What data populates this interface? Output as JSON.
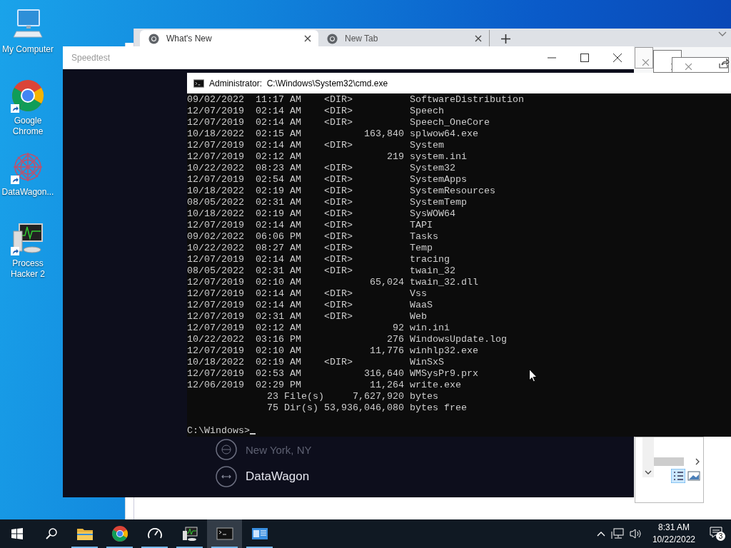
{
  "desktop": {
    "icons": [
      {
        "kind": "computer",
        "label": "My Computer",
        "shortcut": false
      },
      {
        "kind": "chrome",
        "label": "Google Chrome",
        "shortcut": true
      },
      {
        "kind": "mandala",
        "label": "DataWagon...",
        "shortcut": true
      },
      {
        "kind": "monitor",
        "label": "Process Hacker 2",
        "shortcut": true
      }
    ]
  },
  "browser": {
    "tabs": [
      {
        "title": "What's New",
        "selected": true
      },
      {
        "title": "New Tab",
        "selected": false
      }
    ]
  },
  "speedtest": {
    "title": "Speedtest",
    "servers": [
      {
        "kind": "location",
        "label": "New York, NY"
      },
      {
        "kind": "provider",
        "label": "DataWagon"
      }
    ]
  },
  "cmd": {
    "title": "Administrator:  C:\\Windows\\System32\\cmd.exe",
    "rows": [
      {
        "date": "09/02/2022",
        "time": "11:17 AM",
        "type": "<DIR>",
        "name": "SoftwareDistribution"
      },
      {
        "date": "12/07/2019",
        "time": "02:14 AM",
        "type": "<DIR>",
        "name": "Speech"
      },
      {
        "date": "12/07/2019",
        "time": "02:14 AM",
        "type": "<DIR>",
        "name": "Speech_OneCore"
      },
      {
        "date": "10/18/2022",
        "time": "02:15 AM",
        "size": "163,840",
        "name": "splwow64.exe"
      },
      {
        "date": "12/07/2019",
        "time": "02:14 AM",
        "type": "<DIR>",
        "name": "System"
      },
      {
        "date": "12/07/2019",
        "time": "02:12 AM",
        "size": "219",
        "name": "system.ini"
      },
      {
        "date": "10/22/2022",
        "time": "08:23 AM",
        "type": "<DIR>",
        "name": "System32"
      },
      {
        "date": "12/07/2019",
        "time": "02:54 AM",
        "type": "<DIR>",
        "name": "SystemApps"
      },
      {
        "date": "10/18/2022",
        "time": "02:19 AM",
        "type": "<DIR>",
        "name": "SystemResources"
      },
      {
        "date": "08/05/2022",
        "time": "02:31 AM",
        "type": "<DIR>",
        "name": "SystemTemp"
      },
      {
        "date": "10/18/2022",
        "time": "02:19 AM",
        "type": "<DIR>",
        "name": "SysWOW64"
      },
      {
        "date": "12/07/2019",
        "time": "02:14 AM",
        "type": "<DIR>",
        "name": "TAPI"
      },
      {
        "date": "09/02/2022",
        "time": "06:06 PM",
        "type": "<DIR>",
        "name": "Tasks"
      },
      {
        "date": "10/22/2022",
        "time": "08:27 AM",
        "type": "<DIR>",
        "name": "Temp"
      },
      {
        "date": "12/07/2019",
        "time": "02:14 AM",
        "type": "<DIR>",
        "name": "tracing"
      },
      {
        "date": "08/05/2022",
        "time": "02:31 AM",
        "type": "<DIR>",
        "name": "twain_32"
      },
      {
        "date": "12/07/2019",
        "time": "02:10 AM",
        "size": "65,024",
        "name": "twain_32.dll"
      },
      {
        "date": "12/07/2019",
        "time": "02:14 AM",
        "type": "<DIR>",
        "name": "Vss"
      },
      {
        "date": "12/07/2019",
        "time": "02:14 AM",
        "type": "<DIR>",
        "name": "WaaS"
      },
      {
        "date": "12/07/2019",
        "time": "02:31 AM",
        "type": "<DIR>",
        "name": "Web"
      },
      {
        "date": "12/07/2019",
        "time": "02:12 AM",
        "size": "92",
        "name": "win.ini"
      },
      {
        "date": "10/22/2022",
        "time": "03:16 PM",
        "size": "276",
        "name": "WindowsUpdate.log"
      },
      {
        "date": "12/07/2019",
        "time": "02:10 AM",
        "size": "11,776",
        "name": "winhlp32.exe"
      },
      {
        "date": "10/18/2022",
        "time": "02:19 AM",
        "type": "<DIR>",
        "name": "WinSxS"
      },
      {
        "date": "12/07/2019",
        "time": "02:53 AM",
        "size": "316,640",
        "name": "WMSysPr9.prx"
      },
      {
        "date": "12/06/2019",
        "time": "02:29 PM",
        "size": "11,264",
        "name": "write.exe"
      }
    ],
    "summary": [
      {
        "label": "23 File(s)",
        "amount": "7,627,920",
        "unit": "bytes"
      },
      {
        "label": "75 Dir(s)",
        "amount": "53,936,046,080",
        "unit": "bytes free"
      }
    ],
    "prompt": "C:\\Windows>"
  },
  "taskbar": {
    "apps": [
      {
        "kind": "folder",
        "running": true,
        "active": false
      },
      {
        "kind": "chrome",
        "running": true,
        "active": false
      },
      {
        "kind": "gauge",
        "running": true,
        "active": false
      },
      {
        "kind": "monitor",
        "running": true,
        "active": false
      },
      {
        "kind": "terminal",
        "running": true,
        "active": true
      },
      {
        "kind": "panel",
        "running": true,
        "active": false
      }
    ],
    "clock": {
      "time": "8:31 AM",
      "date": "10/22/2022"
    },
    "notifications": "3"
  }
}
